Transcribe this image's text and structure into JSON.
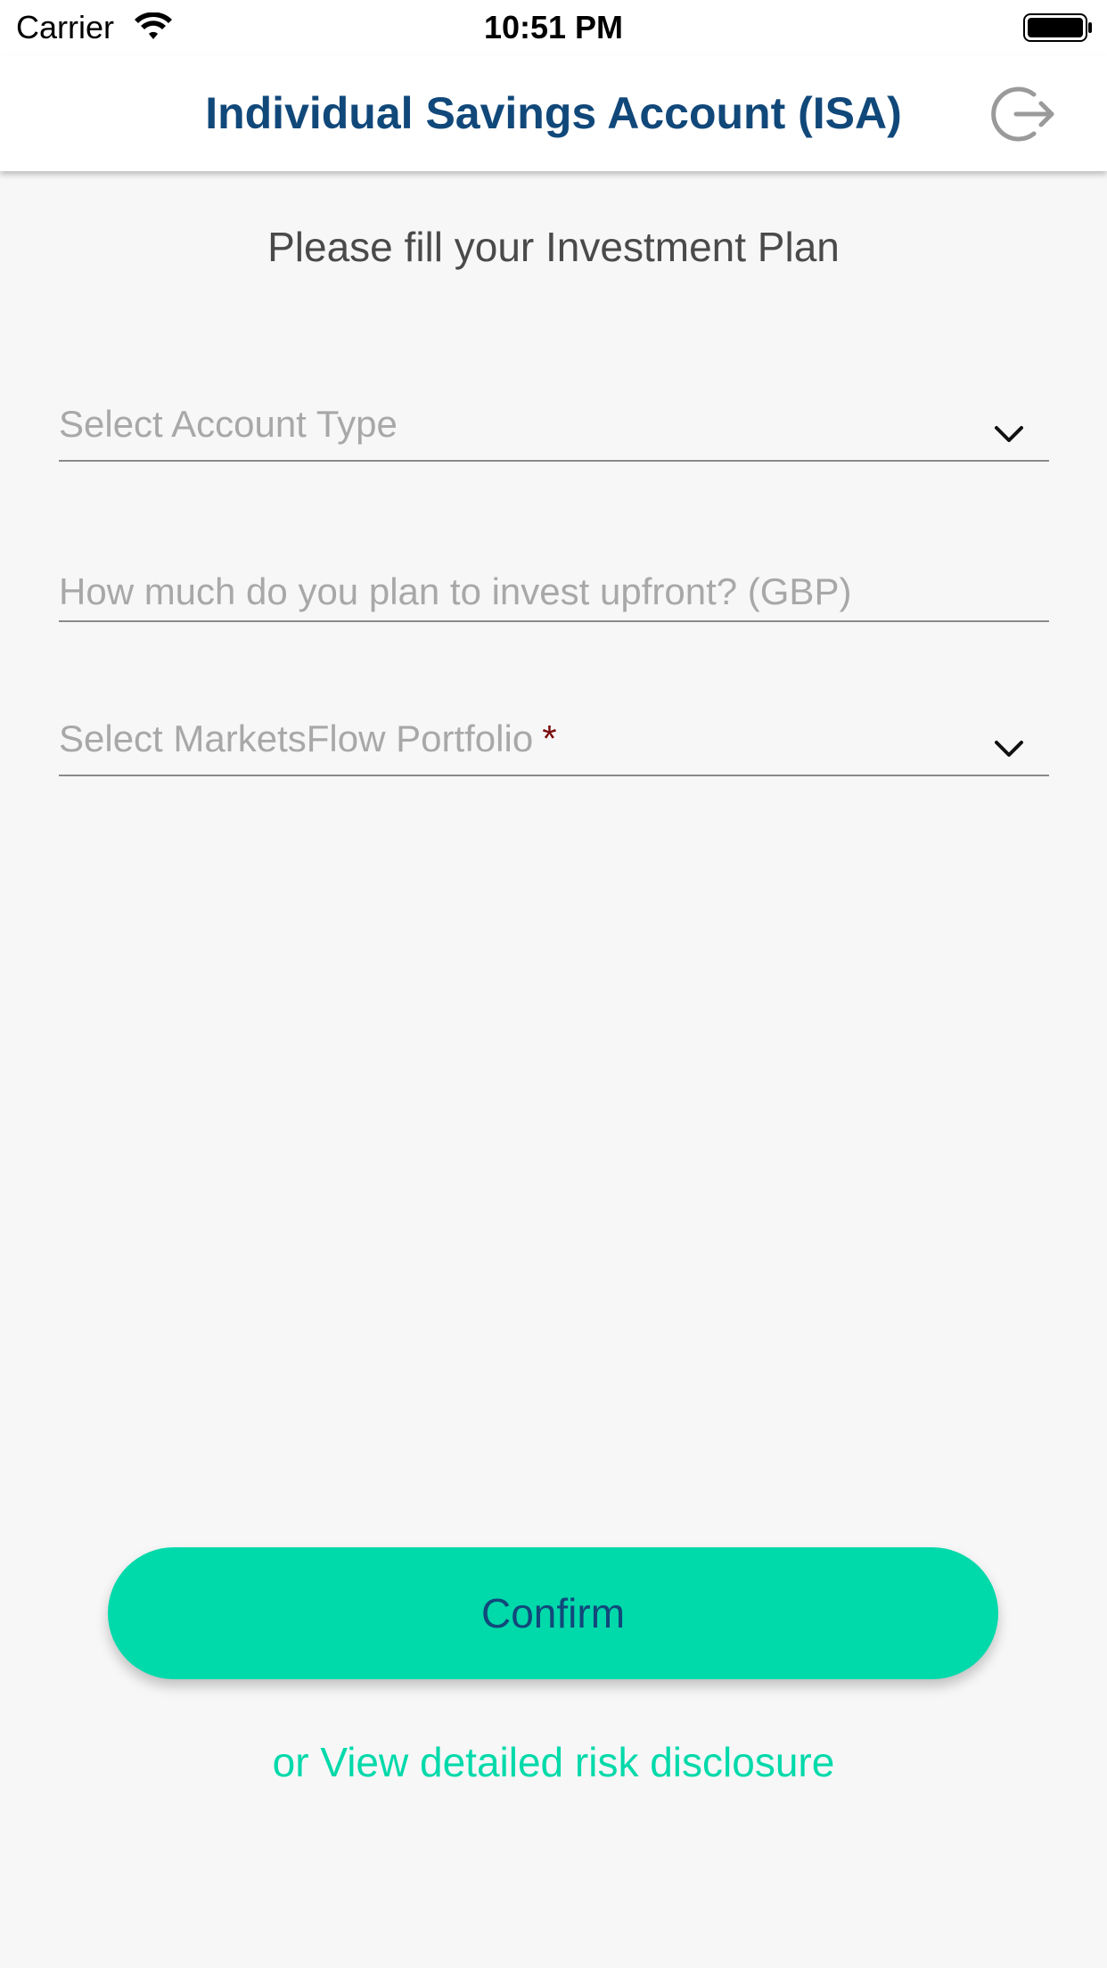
{
  "status_bar": {
    "carrier": "Carrier",
    "time": "10:51 PM",
    "icons": [
      "wifi-icon",
      "battery-icon"
    ]
  },
  "header": {
    "title": "Individual Savings Account (ISA)",
    "logout_icon": "logout-icon"
  },
  "form": {
    "heading": "Please fill your Investment Plan",
    "account_type": {
      "placeholder": "Select Account Type",
      "icon": "chevron-down-icon"
    },
    "upfront_amount": {
      "placeholder": "How much do you plan to invest upfront? (GBP)"
    },
    "portfolio": {
      "placeholder": "Select MarketsFlow Portfolio",
      "required_marker": "*",
      "icon": "chevron-down-icon"
    }
  },
  "actions": {
    "confirm_label": "Confirm",
    "risk_link": "or View detailed risk disclosure"
  },
  "colors": {
    "brand_navy": "#11487a",
    "accent_green": "#00d9aa",
    "background": "#f7f7f7",
    "required": "#7a0c0c"
  }
}
